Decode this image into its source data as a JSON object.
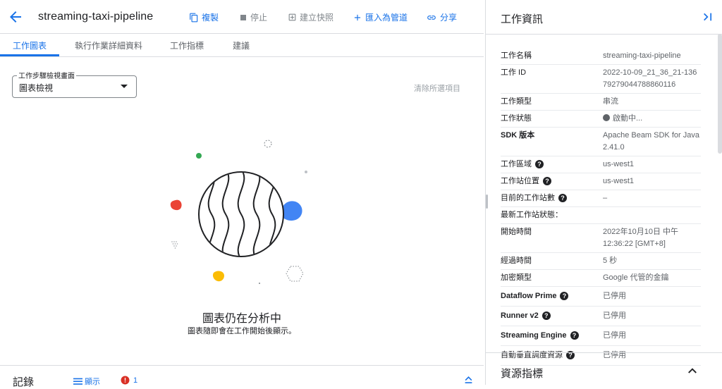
{
  "header": {
    "title": "streaming-taxi-pipeline",
    "actions": {
      "copy": "複製",
      "stop": "停止",
      "snapshot": "建立快照",
      "import": "匯入為管道",
      "share": "分享"
    }
  },
  "tabs": {
    "graph": "工作圖表",
    "details": "執行作業詳細資料",
    "metrics": "工作指標",
    "recommendations": "建議"
  },
  "graph": {
    "view_legend": "工作步驟檢視畫面",
    "view_value": "圖表檢視",
    "clear_selection": "清除所選項目",
    "empty_title": "圖表仍在分析中",
    "empty_subtitle": "圖表隨即會在工作開始後顯示。"
  },
  "logs": {
    "title": "記錄",
    "show": "顯示",
    "error_count": "1"
  },
  "info_panel": {
    "title": "工作資訊",
    "rows": [
      {
        "label": "工作名稱",
        "value": "streaming-taxi-pipeline"
      },
      {
        "label": "工作 ID",
        "value": "2022-10-09_21_36_21-13679279044788860116"
      },
      {
        "label": "工作類型",
        "value": "串流"
      },
      {
        "label": "工作狀態",
        "value": "啟動中..."
      },
      {
        "label": "SDK 版本",
        "value": "Apache Beam SDK for Java 2.41.0"
      },
      {
        "label": "工作區域",
        "value": "us-west1"
      },
      {
        "label": "工作站位置",
        "value": "us-west1"
      },
      {
        "label": "目前的工作站數",
        "value": "–"
      },
      {
        "label": "最新工作站狀態：",
        "value": ""
      },
      {
        "label": "開始時間",
        "value": "2022年10月10日 中午12:36:22 [GMT+8]"
      },
      {
        "label": "經過時間",
        "value": "5 秒"
      },
      {
        "label": "加密類型",
        "value": "Google 代管的金鑰"
      },
      {
        "label": "Dataflow Prime",
        "value": "已停用"
      },
      {
        "label": "Runner v2",
        "value": "已停用"
      },
      {
        "label": "Streaming Engine",
        "value": "已停用"
      },
      {
        "label": "自動垂直調度資源",
        "value": "已停用"
      }
    ],
    "resource_metrics": "資源指標"
  },
  "colors": {
    "accent": "#1a73e8",
    "red": "#ea4335",
    "blue": "#4285f4",
    "yellow": "#fbbc04",
    "green": "#34a853"
  }
}
